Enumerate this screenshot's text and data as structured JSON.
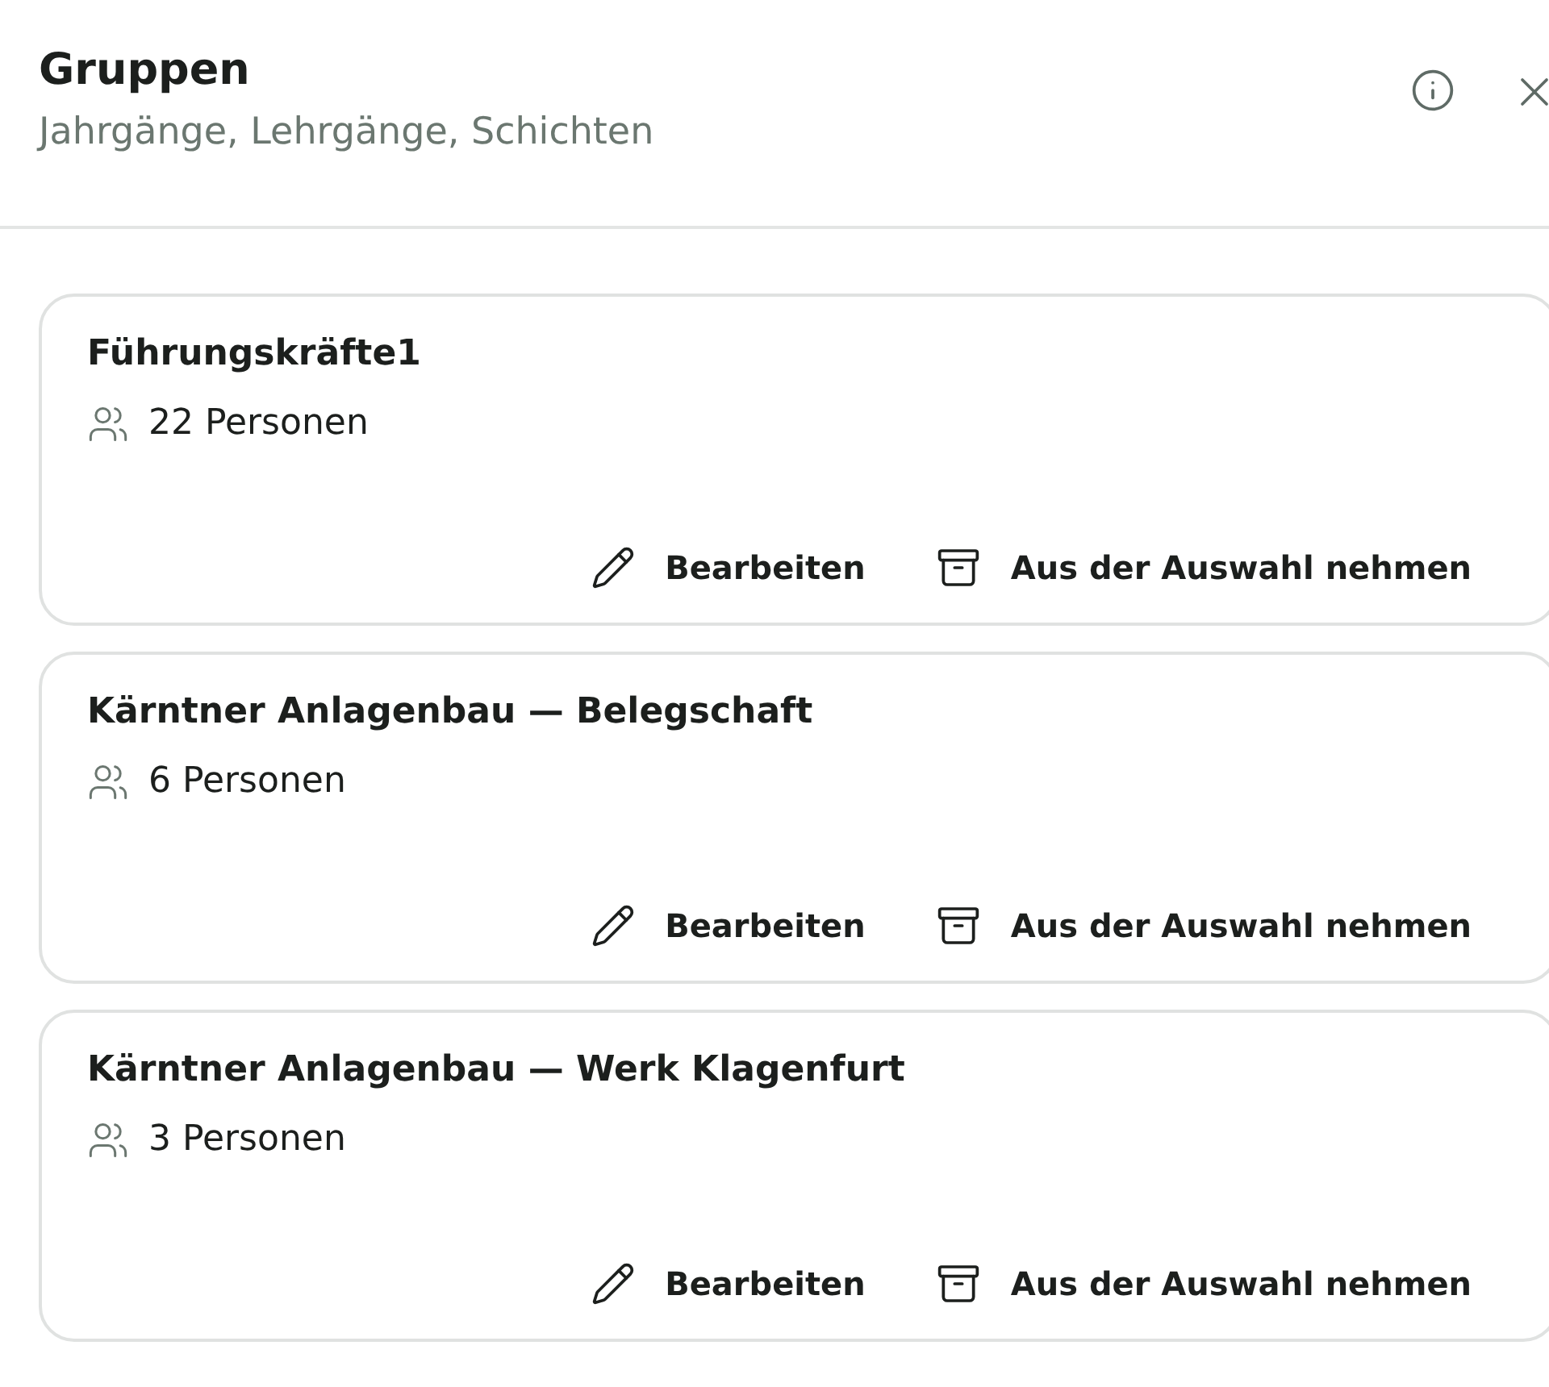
{
  "header": {
    "title": "Gruppen",
    "subtitle": "Jahrgänge, Lehrgänge, Schichten"
  },
  "groups": [
    {
      "name": "Führungskräfte1",
      "members": "22 Personen",
      "actions": [
        "Bearbeiten",
        "Aus der Auswahl nehmen"
      ]
    },
    {
      "name": "Kärntner Anlagenbau — Belegschaft",
      "members": "6 Personen",
      "actions": [
        "Bearbeiten",
        "Aus der Auswahl nehmen"
      ]
    },
    {
      "name": "Kärntner Anlagenbau — Werk Klagenfurt",
      "members": "3 Personen",
      "actions": [
        "Bearbeiten",
        "Aus der Auswahl nehmen"
      ]
    }
  ]
}
